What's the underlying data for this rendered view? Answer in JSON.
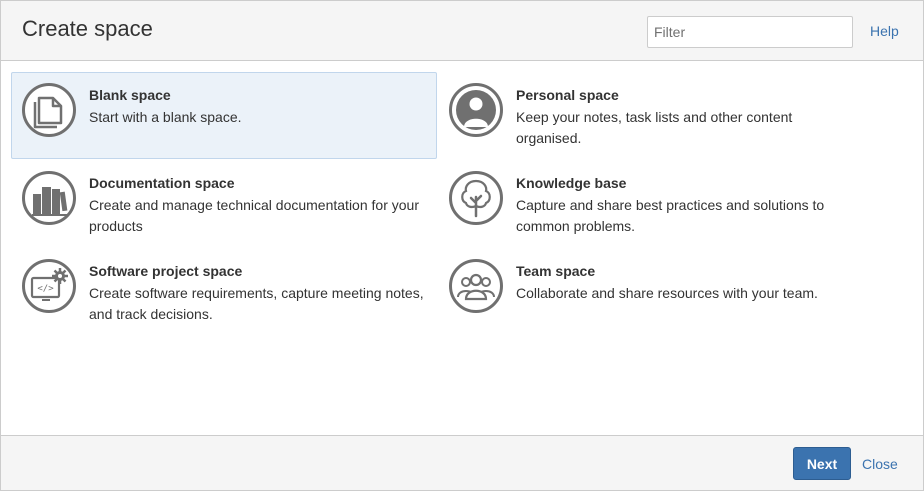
{
  "dialog": {
    "title": "Create space",
    "filter_placeholder": "Filter",
    "help_label": "Help"
  },
  "spaces": [
    {
      "name": "Blank space",
      "description": "Start with a blank space.",
      "icon": "blank-page-icon",
      "selected": true
    },
    {
      "name": "Personal space",
      "description": "Keep your notes, task lists and other content organised.",
      "icon": "person-icon",
      "selected": false
    },
    {
      "name": "Documentation space",
      "description": "Create and manage technical documentation for your products",
      "icon": "books-icon",
      "selected": false
    },
    {
      "name": "Knowledge base",
      "description": "Capture and share best practices and solutions to common problems.",
      "icon": "tree-icon",
      "selected": false
    },
    {
      "name": "Software project space",
      "description": "Create software requirements, capture meeting notes, and track decisions.",
      "icon": "code-gear-icon",
      "selected": false
    },
    {
      "name": "Team space",
      "description": "Collaborate and share resources with your team.",
      "icon": "team-icon",
      "selected": false
    }
  ],
  "footer": {
    "next_label": "Next",
    "close_label": "Close"
  },
  "colors": {
    "accent": "#3b73af",
    "selected_bg": "#ebf2f9",
    "icon_gray": "#707070"
  }
}
